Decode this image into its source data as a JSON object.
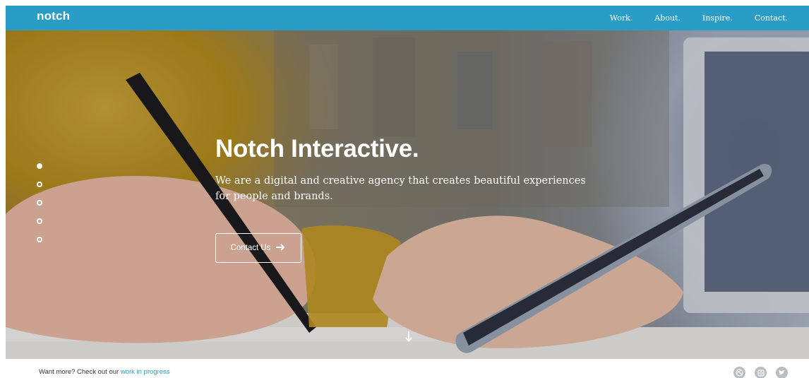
{
  "nav": {
    "logo": "notch",
    "links": [
      "Work.",
      "About.",
      "Inspire.",
      "Contact."
    ]
  },
  "hero": {
    "title": "Notch Interactive.",
    "subtitle": "We are a digital and creative agency that creates beautiful experiences for people and brands.",
    "cta_label": "Contact Us",
    "cta_icon": "arrow-right-icon",
    "scroll_icon": "arrow-down-icon",
    "slides_count": 5,
    "active_slide": 0
  },
  "footer": {
    "text": "Want more? Check out our",
    "link_text": "work in progress",
    "social": [
      "dribbble-icon",
      "instagram-icon",
      "twitter-icon"
    ]
  },
  "colors": {
    "brand": "#2a9dc6",
    "footer_icon": "#b9bdc2"
  }
}
